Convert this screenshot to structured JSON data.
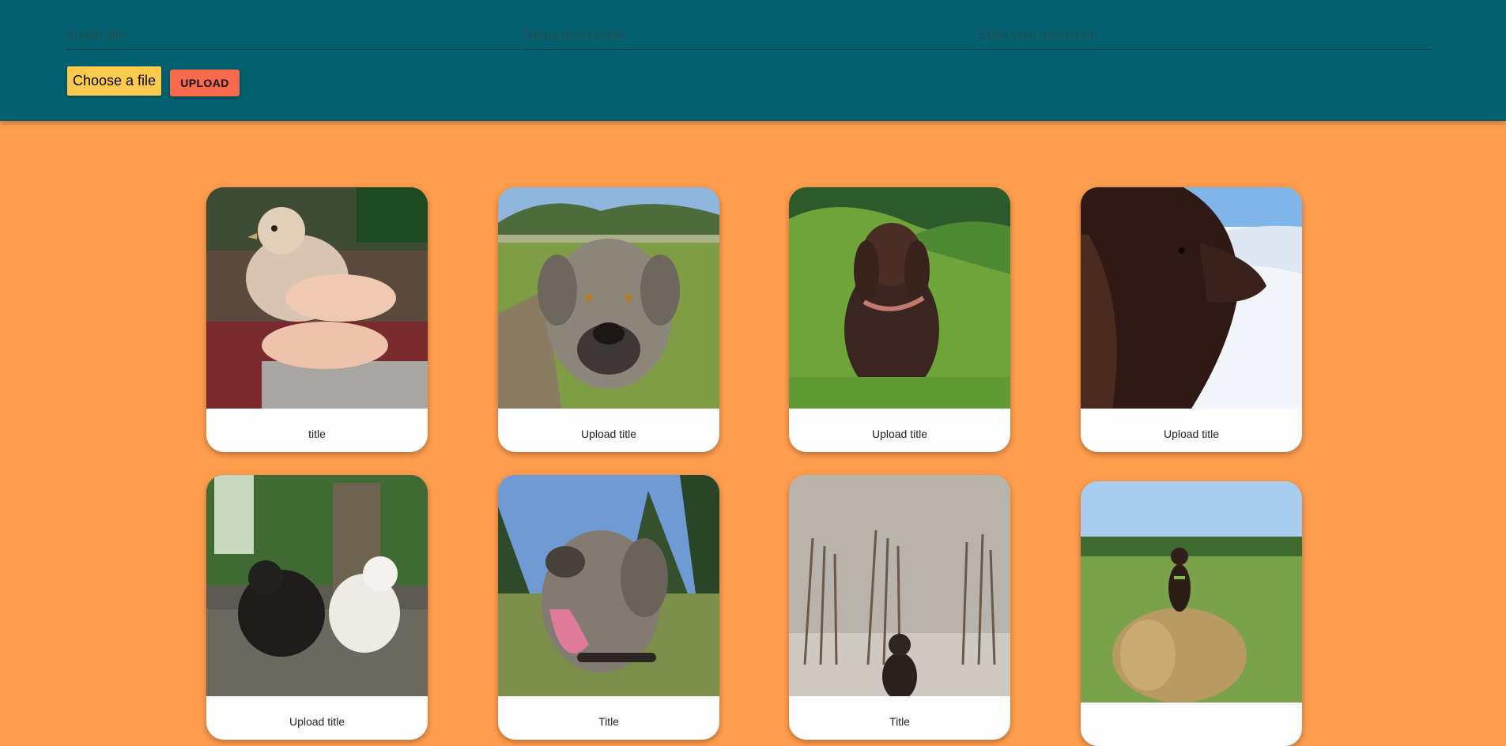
{
  "form": {
    "title_placeholder": "Image title",
    "description_placeholder": "Image description",
    "username_placeholder": "Enter your username",
    "choose_file_label": "Choose a file",
    "upload_label": "UPLOAD"
  },
  "gallery": [
    {
      "title": "title",
      "subject": "chick held in hands"
    },
    {
      "title": "Upload title",
      "subject": "grey dog close-up in meadow"
    },
    {
      "title": "Upload title",
      "subject": "brown spaniel sitting in green hills"
    },
    {
      "title": "Upload title",
      "subject": "brown spaniel profile with snow"
    },
    {
      "title": "Upload title",
      "subject": "black and white silkie chickens"
    },
    {
      "title": "Title",
      "subject": "happy grey dog with tongue out"
    },
    {
      "title": "Title",
      "subject": "dog on sandy beach with sticks"
    },
    {
      "title": "",
      "subject": "dog sitting on hay bale"
    }
  ],
  "colors": {
    "header_bg": "#03606e",
    "page_bg": "#ff9d4e",
    "choose_file_bg": "#fccb4e",
    "upload_bg": "#f76b4c",
    "card_bg": "#fdfdfd"
  }
}
